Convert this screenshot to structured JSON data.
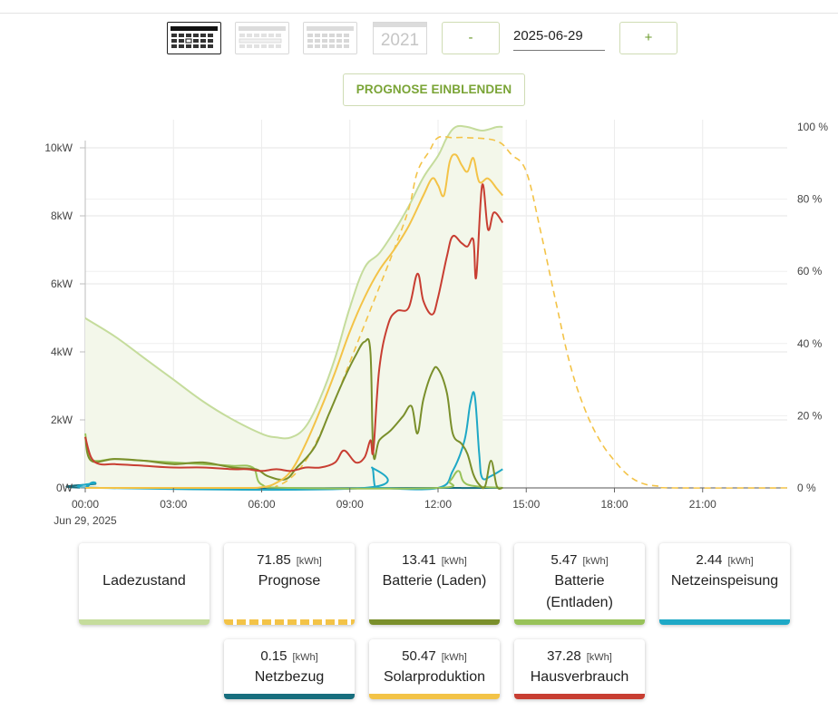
{
  "toolbar": {
    "year_label": "2021",
    "minus_label": "-",
    "plus_label": "+",
    "date_value": "2025-06-29",
    "forecast_button": "PROGNOSE EINBLENDEN"
  },
  "chart_data": {
    "type": "line",
    "x_unit": "time of day (hours)",
    "x_ticks": [
      "00:00",
      "03:00",
      "06:00",
      "09:00",
      "12:00",
      "15:00",
      "18:00",
      "21:00"
    ],
    "x_date_label": "Jun 29, 2025",
    "y_left_ticks": [
      "0W",
      "2kW",
      "4kW",
      "6kW",
      "8kW",
      "10kW"
    ],
    "y_left_range_kw": [
      0,
      10.5
    ],
    "y_right_ticks": [
      "0 %",
      "20 %",
      "40 %",
      "60 %",
      "80 %",
      "100 %"
    ],
    "y_right_range_pct": [
      0,
      100
    ],
    "grid": true,
    "series": [
      {
        "name": "Ladezustand",
        "color": "#c5dc9c",
        "axis": "right",
        "style": "area",
        "x": [
          0,
          1,
          2,
          3,
          4,
          5,
          6,
          6.5,
          7,
          7.5,
          8,
          8.5,
          9,
          9.5,
          10,
          10.5,
          11,
          11.5,
          12,
          12.3,
          12.6,
          13,
          13.5,
          14,
          14.2
        ],
        "y": [
          47,
          42,
          36,
          30,
          24,
          19,
          15,
          14,
          14,
          17,
          25,
          36,
          50,
          61,
          65,
          71,
          78,
          86,
          92,
          97,
          100,
          100,
          99,
          100,
          100
        ]
      },
      {
        "name": "Prognose",
        "color": "#f3c347",
        "axis": "left",
        "style": "dashed",
        "x": [
          0,
          6,
          6.5,
          7,
          7.5,
          8,
          8.5,
          9,
          9.5,
          10,
          10.5,
          11,
          11.3,
          11.7,
          12,
          12.5,
          13,
          14,
          14.5,
          15,
          15.5,
          16,
          16.5,
          17,
          17.5,
          18,
          18.5,
          19,
          19.5,
          20,
          24
        ],
        "y": [
          0,
          0,
          0.05,
          0.3,
          0.8,
          1.6,
          2.6,
          3.7,
          4.8,
          5.9,
          7.0,
          8.2,
          9.3,
          9.9,
          10.3,
          10.3,
          10.3,
          10.2,
          9.8,
          9.3,
          7.5,
          5.5,
          3.6,
          2.3,
          1.4,
          0.8,
          0.35,
          0.12,
          0.05,
          0,
          0
        ]
      },
      {
        "name": "Batterie (Laden)",
        "color": "#7a8f2b",
        "axis": "left",
        "style": "line",
        "x": [
          0,
          0.2,
          1,
          2,
          3,
          4,
          5,
          5.8,
          6.2,
          6.8,
          7.2,
          7.8,
          8.3,
          8.8,
          9.2,
          9.5,
          9.7,
          9.8,
          10,
          10.4,
          10.8,
          11.1,
          11.3,
          11.5,
          11.8,
          12,
          12.3,
          12.5,
          12.8,
          13,
          13.2,
          13.4,
          13.6,
          13.8,
          14,
          14.2
        ],
        "y": [
          1.5,
          0.8,
          0.85,
          0.8,
          0.7,
          0.75,
          0.6,
          0.55,
          0.35,
          0.25,
          0.6,
          1.2,
          2.2,
          3.2,
          3.9,
          4.3,
          4.0,
          1.0,
          1.4,
          1.7,
          2.1,
          2.4,
          1.6,
          2.6,
          3.4,
          3.5,
          2.8,
          1.6,
          1.3,
          1.0,
          0.4,
          0.1,
          0.05,
          0.8,
          0.05,
          0
        ]
      },
      {
        "name": "Batterie (Entladen)",
        "color": "#98c259",
        "axis": "left",
        "style": "line",
        "x": [
          0,
          0.2,
          1,
          2,
          3,
          4,
          5,
          5.7,
          6,
          7,
          12,
          12.4,
          12.7,
          13,
          14.2
        ],
        "y": [
          1.6,
          0.85,
          0.85,
          0.8,
          0.75,
          0.7,
          0.65,
          0.6,
          0.1,
          0,
          0,
          0.2,
          0.5,
          0.1,
          0
        ]
      },
      {
        "name": "Netzeinspeisung",
        "color": "#1ea8c6",
        "axis": "left",
        "style": "line",
        "x": [
          0,
          0.2,
          0.35,
          0.5,
          9.5,
          9.75,
          9.85,
          10,
          12,
          12.5,
          12.9,
          13.1,
          13.25,
          13.4,
          13.5,
          13.8,
          14.2
        ],
        "y": [
          0,
          0.15,
          0.15,
          0,
          0,
          0.6,
          0.05,
          0,
          0,
          0.5,
          1.4,
          2.5,
          2.7,
          1.0,
          0.3,
          0.35,
          0.55
        ]
      },
      {
        "name": "Netzbezug",
        "color": "#176e7e",
        "axis": "left",
        "style": "line",
        "x": [
          0,
          0.2,
          0.35,
          0.5,
          14.2
        ],
        "y": [
          0,
          0.12,
          0.12,
          0,
          0
        ]
      },
      {
        "name": "Solarproduktion",
        "color": "#f3c347",
        "axis": "left",
        "style": "line",
        "x": [
          0,
          5,
          6,
          6.5,
          7,
          7.5,
          8,
          8.5,
          9,
          9.5,
          10,
          10.5,
          11,
          11.5,
          11.8,
          12,
          12.2,
          12.4,
          12.6,
          12.8,
          13,
          13.2,
          13.4,
          13.7,
          14,
          14.2
        ],
        "y": [
          0,
          0,
          0.02,
          0.15,
          0.5,
          1.3,
          2.3,
          3.4,
          4.6,
          5.6,
          6.4,
          7.0,
          7.7,
          8.6,
          9.1,
          8.9,
          8.6,
          9.6,
          9.8,
          9.5,
          9.3,
          9.7,
          9.0,
          9.1,
          8.8,
          8.6
        ]
      },
      {
        "name": "Hausverbrauch",
        "color": "#c83e32",
        "axis": "left",
        "style": "line",
        "x": [
          0,
          0.2,
          0.5,
          1,
          2,
          3,
          4,
          5,
          5.5,
          6,
          6.5,
          7,
          7.5,
          8,
          8.5,
          8.8,
          9.2,
          9.5,
          9.7,
          9.8,
          10,
          10.3,
          10.6,
          11,
          11.3,
          11.5,
          11.8,
          12,
          12.3,
          12.5,
          12.8,
          13,
          13.2,
          13.3,
          13.5,
          13.7,
          13.9,
          14.2
        ],
        "y": [
          1.5,
          0.9,
          0.7,
          0.7,
          0.65,
          0.6,
          0.6,
          0.55,
          0.55,
          0.5,
          0.55,
          0.5,
          0.6,
          0.6,
          0.75,
          1.1,
          0.75,
          0.9,
          1.4,
          1.1,
          3.5,
          4.8,
          5.2,
          5.3,
          6.3,
          5.5,
          5.1,
          5.6,
          6.8,
          7.4,
          7.2,
          7.1,
          7.3,
          6.2,
          8.9,
          7.6,
          8.1,
          7.8
        ]
      }
    ]
  },
  "summary_cards": [
    {
      "label": "Ladezustand",
      "value": "",
      "unit": "",
      "color": "#c5dc9c"
    },
    {
      "label": "Prognose",
      "value": "71.85",
      "unit": "[kWh]",
      "color": "#f3c347"
    },
    {
      "label": "Batterie (Laden)",
      "value": "13.41",
      "unit": "[kWh]",
      "color": "#7a8f2b"
    },
    {
      "label": "Batterie (Entladen)",
      "value": "5.47",
      "unit": "[kWh]",
      "color": "#98c259"
    },
    {
      "label": "Netzeinspeisung",
      "value": "2.44",
      "unit": "[kWh]",
      "color": "#1ea8c6"
    },
    {
      "label": "Netzbezug",
      "value": "0.15",
      "unit": "[kWh]",
      "color": "#176e7e"
    },
    {
      "label": "Solarproduktion",
      "value": "50.47",
      "unit": "[kWh]",
      "color": "#f3c347"
    },
    {
      "label": "Hausverbrauch",
      "value": "37.28",
      "unit": "[kWh]",
      "color": "#c83e32"
    }
  ]
}
